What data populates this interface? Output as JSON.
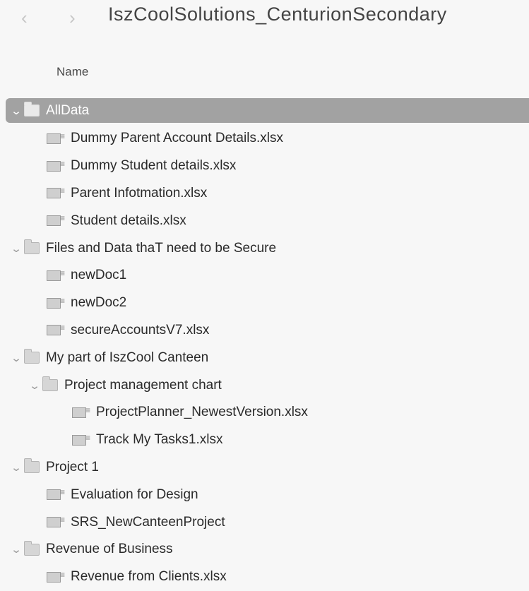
{
  "window": {
    "title": "IszCoolSolutions_CenturionSecondary"
  },
  "nav": {
    "back_glyph": "‹",
    "forward_glyph": "›"
  },
  "columns": {
    "name": "Name"
  },
  "tree": [
    {
      "type": "folder",
      "label": "AllData",
      "level": 0,
      "selected": true
    },
    {
      "type": "file",
      "label": "Dummy Parent Account Details.xlsx",
      "level": 1
    },
    {
      "type": "file",
      "label": "Dummy Student details.xlsx",
      "level": 1
    },
    {
      "type": "file",
      "label": "Parent Infotmation.xlsx",
      "level": 1
    },
    {
      "type": "file",
      "label": "Student details.xlsx",
      "level": 1
    },
    {
      "type": "folder",
      "label": "Files and Data thaT need to be Secure",
      "level": 0
    },
    {
      "type": "file",
      "label": "newDoc1",
      "level": 1
    },
    {
      "type": "file",
      "label": "newDoc2",
      "level": 1
    },
    {
      "type": "file",
      "label": "secureAccountsV7.xlsx",
      "level": 1
    },
    {
      "type": "folder",
      "label": "My part of IszCool Canteen",
      "level": 0
    },
    {
      "type": "folder",
      "label": "Project management chart",
      "level": 1
    },
    {
      "type": "file",
      "label": "ProjectPlanner_NewestVersion.xlsx",
      "level": 2
    },
    {
      "type": "file",
      "label": "Track My Tasks1.xlsx",
      "level": 2
    },
    {
      "type": "folder",
      "label": "Project 1",
      "level": 0
    },
    {
      "type": "file",
      "label": "Evaluation for Design",
      "level": 1
    },
    {
      "type": "file",
      "label": "SRS_NewCanteenProject",
      "level": 1
    },
    {
      "type": "folder",
      "label": "Revenue of Business",
      "level": 0
    },
    {
      "type": "file",
      "label": "Revenue from Clients.xlsx",
      "level": 1
    }
  ]
}
